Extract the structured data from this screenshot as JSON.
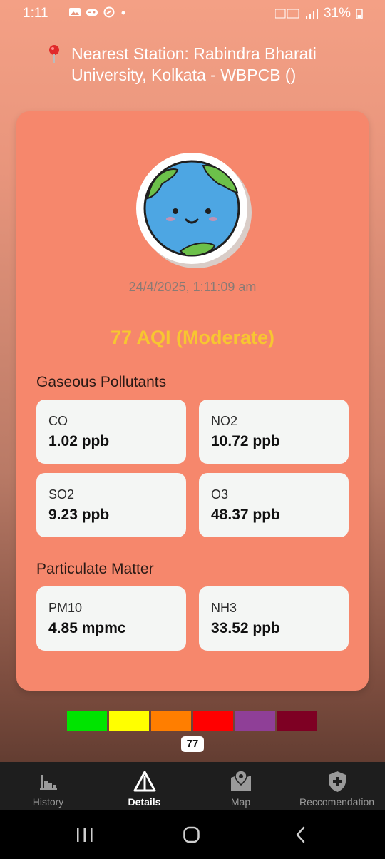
{
  "status": {
    "time": "1:11",
    "battery": "31%"
  },
  "header": {
    "station": "Nearest Station: Rabindra Bharati University, Kolkata - WBPCB ()"
  },
  "card": {
    "timestamp": "24/4/2025, 1:11:09 am",
    "aqi_text": "77 AQI (Moderate)",
    "aqi_color": "#f7c631",
    "gaseous_title": "Gaseous Pollutants",
    "gaseous": [
      {
        "name": "CO",
        "value": "1.02 ppb"
      },
      {
        "name": "NO2",
        "value": "10.72 ppb"
      },
      {
        "name": "SO2",
        "value": "9.23 ppb"
      },
      {
        "name": "O3",
        "value": "48.37 ppb"
      }
    ],
    "particulate_title": "Particulate Matter",
    "particulate": [
      {
        "name": "PM10",
        "value": "4.85 mpmc"
      },
      {
        "name": "NH3",
        "value": "33.52 ppb"
      }
    ]
  },
  "scale": {
    "colors": [
      "#00e400",
      "#ffff00",
      "#ff7e00",
      "#ff0000",
      "#8f3f97",
      "#7e0023"
    ],
    "value": "77"
  },
  "nav": {
    "items": [
      {
        "label": "History",
        "icon": "bar-chart-icon"
      },
      {
        "label": "Details",
        "icon": "warning-triangle-icon"
      },
      {
        "label": "Map",
        "icon": "map-pin-icon"
      },
      {
        "label": "Reccomendation",
        "icon": "shield-plus-icon"
      }
    ]
  }
}
